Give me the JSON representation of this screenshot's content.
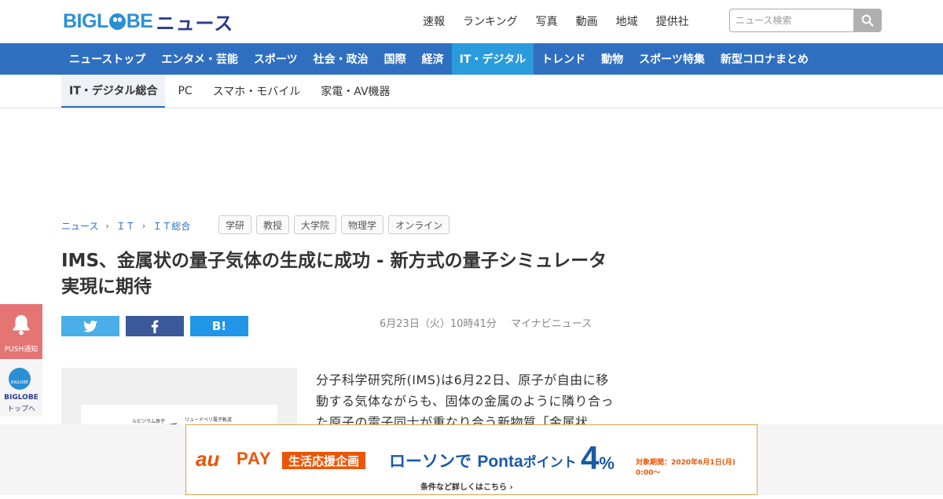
{
  "header": {
    "logo_text": "BIGLOBE",
    "logo_news": "ニュース",
    "top_links": [
      "速報",
      "ランキング",
      "写真",
      "動画",
      "地域",
      "提供社"
    ],
    "search_placeholder": "ニュース検索"
  },
  "category_nav": {
    "items": [
      "ニューストップ",
      "エンタメ・芸能",
      "スポーツ",
      "社会・政治",
      "国際",
      "経済",
      "IT・デジタル",
      "トレンド",
      "動物",
      "スポーツ特集",
      "新型コロナまとめ"
    ],
    "active": "IT・デジタル"
  },
  "sub_nav": {
    "items": [
      "IT・デジタル総合",
      "PC",
      "スマホ・モバイル",
      "家電・AV機器"
    ],
    "active": "IT・デジタル総合"
  },
  "breadcrumb": [
    "ニュース",
    "ＩＴ",
    "ＩＴ総合"
  ],
  "tags": [
    "学研",
    "教授",
    "大学院",
    "物理学",
    "オンライン"
  ],
  "article": {
    "title": "IMS、金属状の量子気体の生成に成功 - 新方式の量子シミュレータ実現に期待",
    "date": "6月23日（火）10時41分",
    "source": "マイナビニュース",
    "body": "分子科学研究所(IMS)は6月22日、原子が自由に移動する気体ながらも、固体の金属のように隣り合った原子の電子同士が重なり合う新物質「金属状",
    "figure_caption_1": "ルビジウム原子",
    "figure_caption_2": "リュードベリ電子軌道"
  },
  "share": {
    "twitter_icon": "twitter-bird-icon",
    "facebook_icon": "facebook-f-icon",
    "hatena_label": "B!"
  },
  "side": {
    "push_label": "PUSH通知",
    "biglobe_circle": "BIGLOBE",
    "biglobe_label": "BIGLOBE",
    "top_label": "トップへ"
  },
  "ad": {
    "au": "au",
    "pay": "PAY",
    "campaign": "生活応援企画",
    "lawson": "ローソンで ",
    "ponta": "Ponta",
    "point": "ポイント",
    "percent_num": "4",
    "percent_sign": "%",
    "period": "対象期間：2020年6月1日(月) 0:00〜",
    "conditions": "条件など詳しくはこちら ›"
  },
  "colors": {
    "brand_blue": "#2b8fd6",
    "nav_blue": "#2f6fc0",
    "nav_active": "#2a9bdc",
    "push_red": "#e57574",
    "ad_orange": "#eb5505"
  }
}
